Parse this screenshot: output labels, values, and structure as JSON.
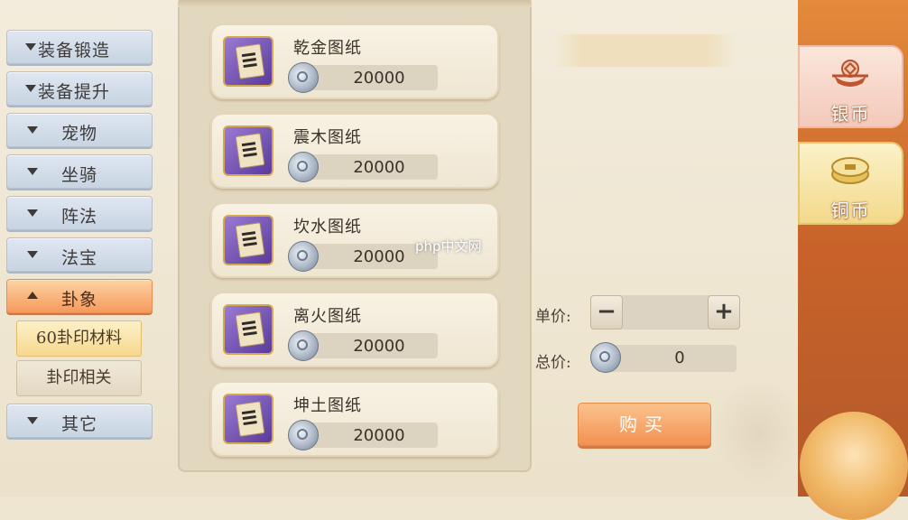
{
  "nav": {
    "items": [
      {
        "label": "装备锻造",
        "active": false
      },
      {
        "label": "装备提升",
        "active": false
      },
      {
        "label": "宠物",
        "active": false
      },
      {
        "label": "坐骑",
        "active": false
      },
      {
        "label": "阵法",
        "active": false
      },
      {
        "label": "法宝",
        "active": false
      },
      {
        "label": "卦象",
        "active": true
      },
      {
        "label": "其它",
        "active": false
      }
    ],
    "subitems": [
      {
        "label": "60卦印材料",
        "selected": true
      },
      {
        "label": "卦印相关",
        "selected": false
      }
    ]
  },
  "items": [
    {
      "name": "乾金图纸",
      "price": "20000"
    },
    {
      "name": "震木图纸",
      "price": "20000"
    },
    {
      "name": "坎水图纸",
      "price": "20000"
    },
    {
      "name": "离火图纸",
      "price": "20000"
    },
    {
      "name": "坤土图纸",
      "price": "20000"
    }
  ],
  "detail": {
    "unit_price_label": "单价:",
    "total_price_label": "总价:",
    "minus_symbol": "−",
    "plus_symbol": "+",
    "total_value": "0",
    "buy_label": "购买"
  },
  "currency_tabs": [
    {
      "label": "银币",
      "icon": "silver-ingot-icon"
    },
    {
      "label": "铜币",
      "icon": "copper-coin-icon"
    }
  ],
  "watermark": "php中文网",
  "colors": {
    "active_tab": "#f69a5c",
    "buy_button": "#f29152",
    "nav_idle": "#c8d4e2"
  }
}
